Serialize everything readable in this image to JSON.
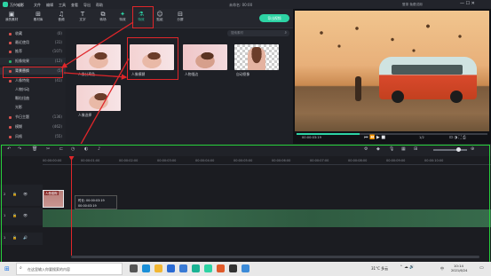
{
  "app": {
    "title": "万兴喵影",
    "menu": [
      "文件",
      "编辑",
      "工具",
      "查看",
      "导出",
      "帮助"
    ],
    "export_time": "未命名: 00:00",
    "account": "登录 免费试用",
    "export_button": "导出视频"
  },
  "toolbar": [
    {
      "icon": "media-icon",
      "glyph": "▣",
      "label": "我的素材"
    },
    {
      "icon": "stock-icon",
      "glyph": "⊞",
      "label": "素材库"
    },
    {
      "icon": "music-icon",
      "glyph": "♫",
      "label": "音频"
    },
    {
      "icon": "text-icon",
      "glyph": "T",
      "label": "文字"
    },
    {
      "icon": "transition-icon",
      "glyph": "⧉",
      "label": "转场"
    },
    {
      "icon": "effects-icon",
      "glyph": "✦",
      "label": "特效"
    },
    {
      "icon": "elements-icon",
      "glyph": "☺",
      "label": "贴纸"
    },
    {
      "icon": "split-icon",
      "glyph": "⊟",
      "label": "分屏"
    }
  ],
  "sidebar": [
    {
      "name": "收藏",
      "count": "(0)",
      "color": "#d9534f"
    },
    {
      "name": "最近使用",
      "count": "(31)",
      "color": "#d9534f"
    },
    {
      "name": "推荐",
      "count": "(107)",
      "color": "#d9534f"
    },
    {
      "name": "抠像效果",
      "count": "(12)",
      "color": "#29b36a"
    },
    {
      "name": "背景替换",
      "count": "(5)",
      "color": "#d9534f"
    },
    {
      "name": "人像特效",
      "count": "(41)",
      "color": "#d9534f"
    },
    {
      "name": "人物抖动",
      "count": "(6)",
      "color": "#d9534f"
    },
    {
      "name": "颗粒扭曲",
      "count": "(32)",
      "color": "#d9534f"
    },
    {
      "name": "光影",
      "count": "(18)",
      "color": "#d9534f"
    },
    {
      "name": "节日主题",
      "count": "(136)",
      "color": "#d9534f"
    },
    {
      "name": "模糊",
      "count": "(462)",
      "color": "#d9534f"
    },
    {
      "name": "风格",
      "count": "(55)",
      "color": "#d9534f"
    }
  ],
  "search": {
    "placeholder": "搜索素材"
  },
  "effects": [
    {
      "label": "人像分离色",
      "style": "girl"
    },
    {
      "label": "人像模糊",
      "style": "girl"
    },
    {
      "label": "人物描边",
      "style": "girl2"
    },
    {
      "label": "自动抠像",
      "style": "checker"
    },
    {
      "label": "人像选择",
      "style": "girl"
    }
  ],
  "preview": {
    "time_current": "00:00:03:19",
    "ratio": "1/2",
    "progress": 0.33
  },
  "timeline": {
    "ruler": [
      "00:00:00:00",
      "00:00:01:00",
      "00:00:02:00",
      "00:00:03:00",
      "00:00:04:00",
      "00:00:05:00",
      "00:00:06:00",
      "00:00:07:00",
      "00:00:08:00",
      "00:00:09:00",
      "00:00:10:00"
    ],
    "clip_label": "人像模糊",
    "tooltip_line1": "时长: 00:00:03:19",
    "tooltip_line2": "00:00:03:19",
    "track_nums": [
      "2",
      "1",
      "1"
    ]
  },
  "taskbar": {
    "search_placeholder": "在这里输入你要搜索的内容",
    "weather": "31°C 多云",
    "time": "10:14",
    "date": "2021/6/24",
    "lang": "中"
  },
  "colors": {
    "accent": "#2dd3a4",
    "highlight_red": "#e0262a",
    "highlight_green": "#27d13b"
  }
}
